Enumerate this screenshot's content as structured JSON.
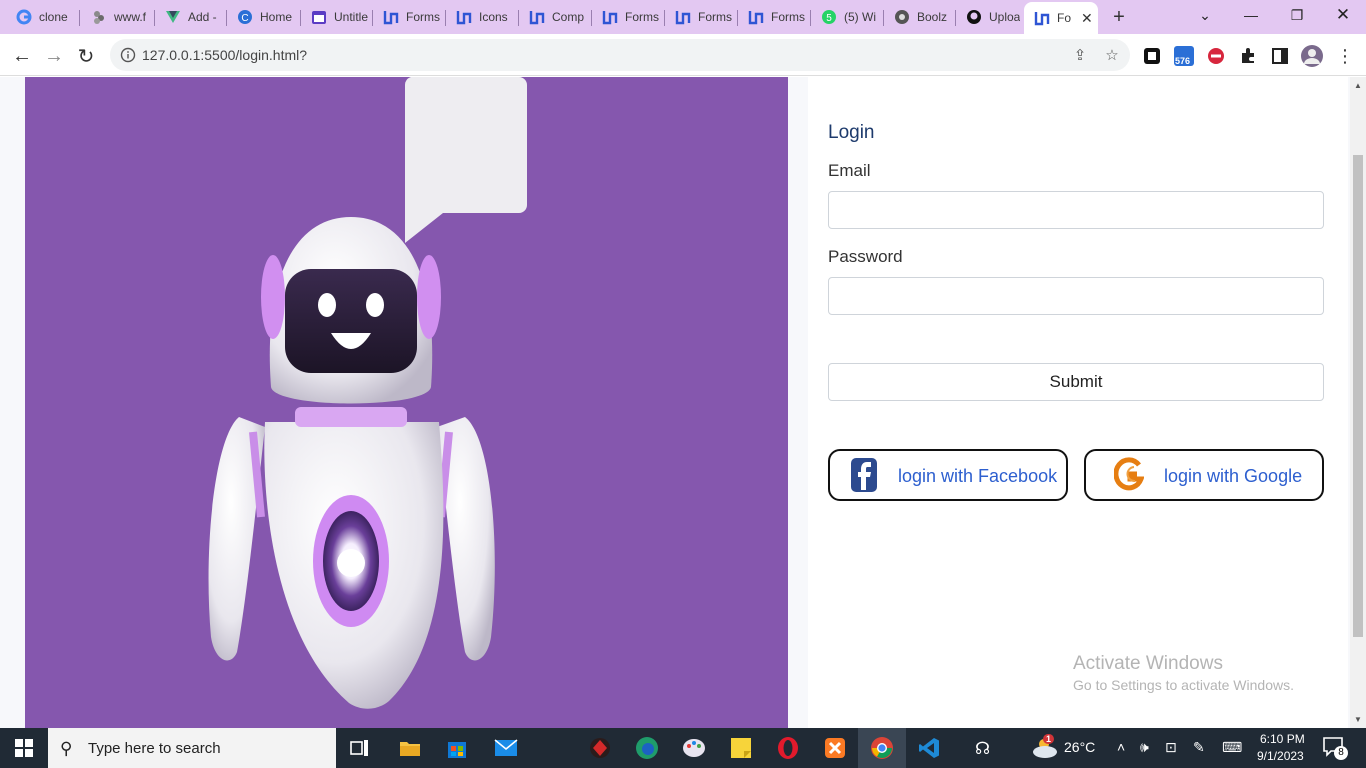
{
  "browser": {
    "tabs": [
      {
        "title": "clone",
        "icon": "google-icon"
      },
      {
        "title": "www.f",
        "icon": "figma-icon"
      },
      {
        "title": "Add -",
        "icon": "vue-icon"
      },
      {
        "title": "Home",
        "icon": "canva-icon"
      },
      {
        "title": "Untitle",
        "icon": "calendar-icon"
      },
      {
        "title": "Forms",
        "icon": "uiverse-icon"
      },
      {
        "title": "Icons",
        "icon": "uiverse-icon"
      },
      {
        "title": "Comp",
        "icon": "uiverse-icon"
      },
      {
        "title": "Forms",
        "icon": "uiverse-icon"
      },
      {
        "title": "Forms",
        "icon": "uiverse-icon"
      },
      {
        "title": "Forms",
        "icon": "uiverse-icon"
      },
      {
        "title": "(5) Wi",
        "icon": "whatsapp-icon"
      },
      {
        "title": "Boolz",
        "icon": "boolz-icon"
      },
      {
        "title": "Uploa",
        "icon": "github-icon"
      },
      {
        "title": "Fo",
        "icon": "uiverse-icon",
        "active": true
      }
    ],
    "new_tab": "+",
    "url": "127.0.0.1:5500/login.html?",
    "extension_badge": "576"
  },
  "page": {
    "login_title": "Login",
    "email_label": "Email",
    "email_value": "",
    "password_label": "Password",
    "password_value": "",
    "submit_label": "Submit",
    "facebook_label": "login with Facebook",
    "google_label": "login with Google",
    "hero_color": "#8557ae",
    "accent_link": "#2d5fcf"
  },
  "watermark": {
    "line1": "Activate Windows",
    "line2": "Go to Settings to activate Windows."
  },
  "taskbar": {
    "search_placeholder": "Type here to search",
    "weather": "26°C",
    "weather_badge": "1",
    "time": "6:10 PM",
    "date": "9/1/2023",
    "notification_count": "8"
  }
}
